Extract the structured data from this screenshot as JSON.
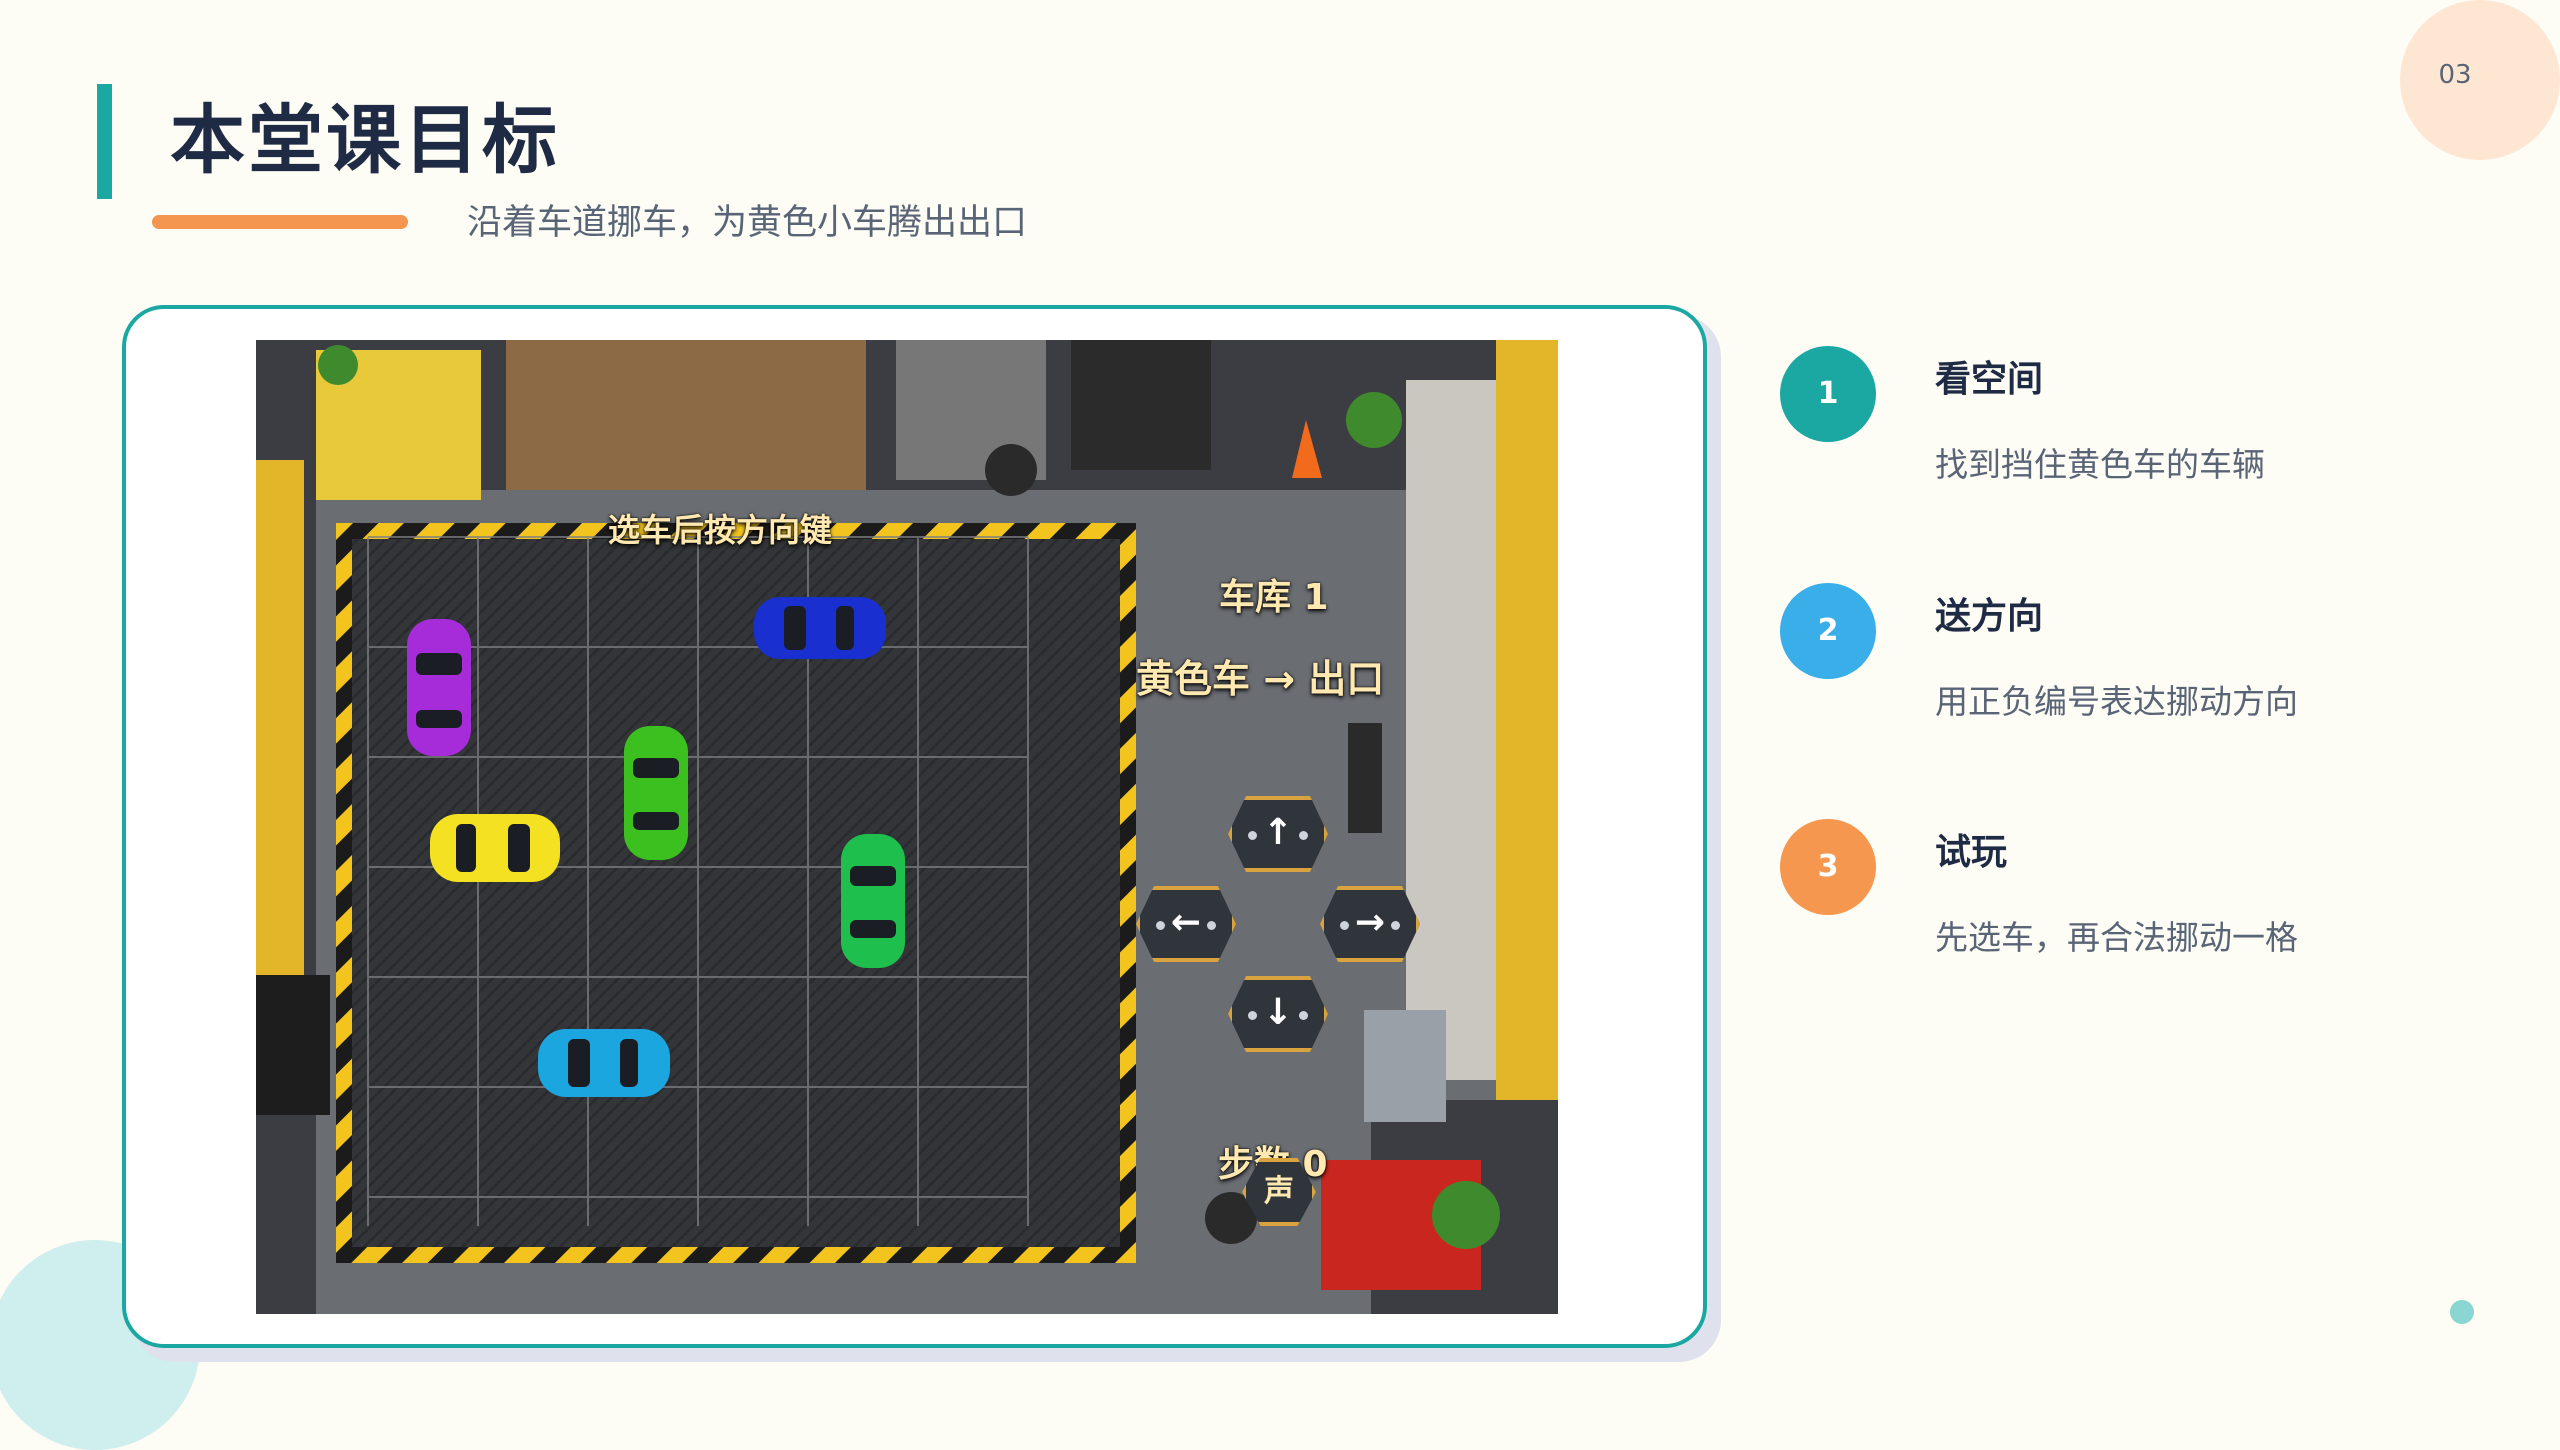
{
  "slide": {
    "title": "本堂课目标",
    "subtitle": "沿着车道挪车，为黄色小车腾出出口",
    "page_number": "03"
  },
  "game": {
    "hint": "选车后按方向键",
    "level": "车库 1",
    "goal": "黄色车 → 出口",
    "steps": "步数 0",
    "sound_button": "声",
    "arrows": {
      "up": "↑",
      "down": "↓",
      "left": "←",
      "right": "→"
    },
    "cars": [
      {
        "color": "#a52cd8"
      },
      {
        "color": "#1a2fcf"
      },
      {
        "color": "#3cc01f"
      },
      {
        "color": "#f4e121"
      },
      {
        "color": "#1fbf4d"
      },
      {
        "color": "#1ca6e0"
      }
    ]
  },
  "steps": [
    {
      "number": "1",
      "title": "看空间",
      "desc": "找到挡住黄色车的车辆",
      "color": "#1ba8a2"
    },
    {
      "number": "2",
      "title": "送方向",
      "desc": "用正负编号表达挪动方向",
      "color": "#3aaee8"
    },
    {
      "number": "3",
      "title": "试玩",
      "desc": "先选车，再合法挪动一格",
      "color": "#f5974e"
    }
  ]
}
